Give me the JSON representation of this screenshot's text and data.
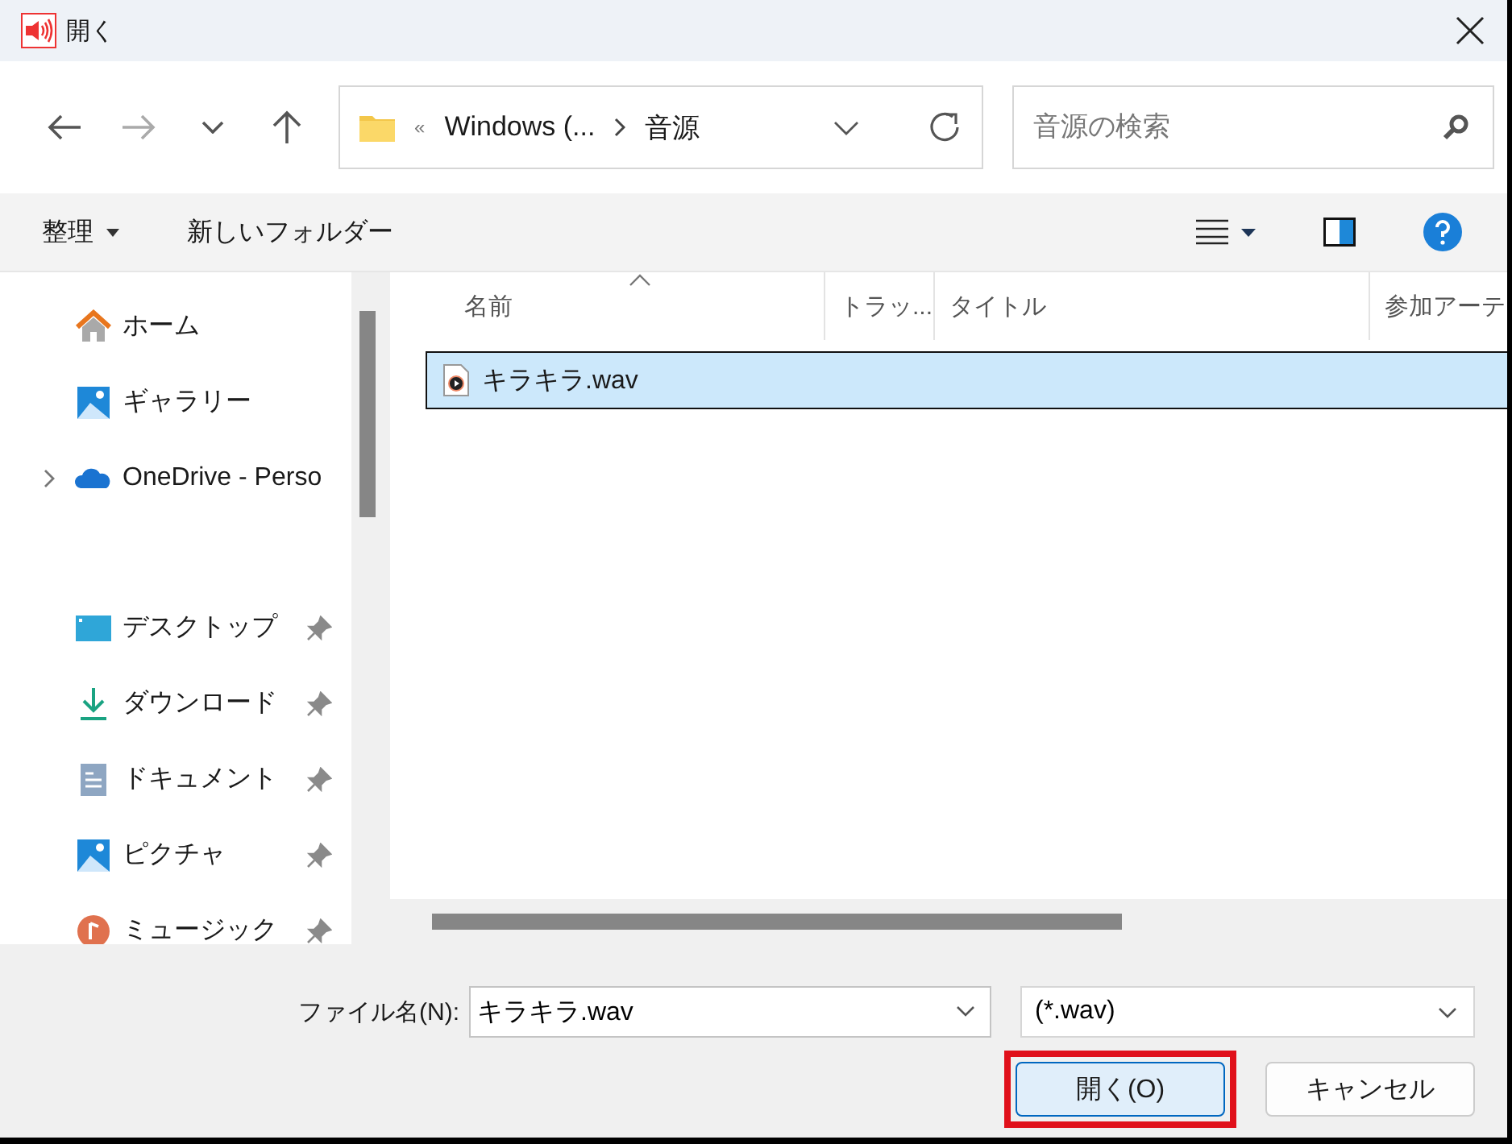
{
  "window": {
    "title": "開く"
  },
  "address_bar": {
    "segments": [
      "«",
      "Windows (...",
      "音源"
    ]
  },
  "search": {
    "placeholder": "音源の検索"
  },
  "toolbar": {
    "organize": "整理",
    "new_folder": "新しいフォルダー"
  },
  "sidebar": {
    "top_items": [
      {
        "label": "ホーム",
        "expandable": false
      },
      {
        "label": "ギャラリー",
        "expandable": false
      },
      {
        "label": "OneDrive - Perso",
        "expandable": true
      }
    ],
    "quick_access": [
      {
        "label": "デスクトップ",
        "pinned": true
      },
      {
        "label": "ダウンロード",
        "pinned": true
      },
      {
        "label": "ドキュメント",
        "pinned": true
      },
      {
        "label": "ピクチャ",
        "pinned": true
      },
      {
        "label": "ミュージック",
        "pinned": true
      }
    ]
  },
  "file_list": {
    "columns": [
      {
        "label": "名前",
        "sorted": true
      },
      {
        "label": "トラッ...",
        "sorted": false
      },
      {
        "label": "タイトル",
        "sorted": false
      },
      {
        "label": "参加アーテ",
        "sorted": false
      }
    ],
    "rows": [
      {
        "name": "キラキラ.wav",
        "selected": true
      }
    ]
  },
  "footer": {
    "file_name_label": "ファイル名(N):",
    "file_name_value": "キラキラ.wav",
    "file_type": "(*.wav)",
    "open_button": "開く(O)",
    "cancel_button": "キャンセル",
    "open_highlighted": true
  }
}
